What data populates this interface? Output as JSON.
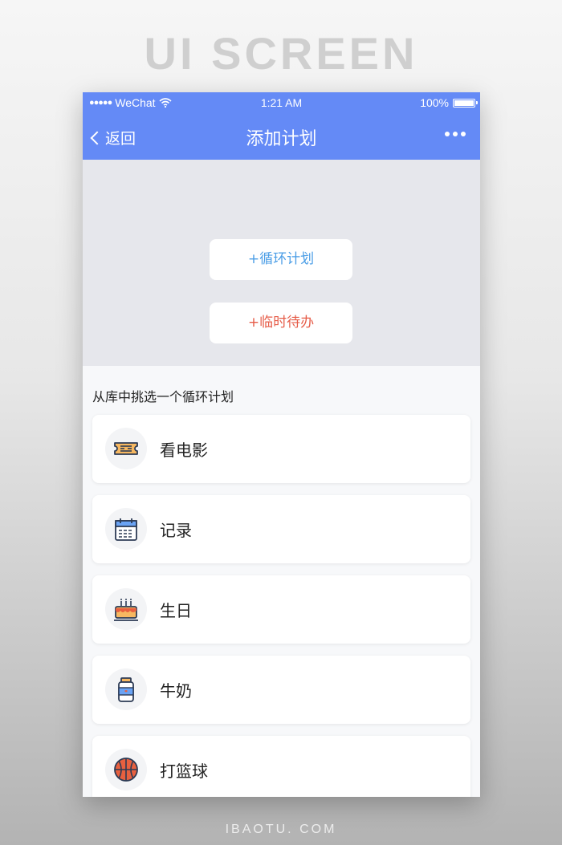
{
  "page": {
    "header_title": "UI SCREEN",
    "footer_text": "IBAOTU. COM"
  },
  "status_bar": {
    "carrier": "WeChat",
    "time": "1:21 AM",
    "battery": "100%"
  },
  "nav": {
    "back_label": "返回",
    "title": "添加计划"
  },
  "hero": {
    "loop_plan_label": "+循环计划",
    "todo_label": "+临时待办",
    "loop_color": "#4a9de6",
    "todo_color": "#e65c48"
  },
  "library": {
    "section_title": "从库中挑选一个循环计划",
    "items": [
      {
        "label": "看电影",
        "icon": "ticket-icon"
      },
      {
        "label": "记录",
        "icon": "calendar-icon"
      },
      {
        "label": "生日",
        "icon": "cake-icon"
      },
      {
        "label": "牛奶",
        "icon": "milk-jar-icon"
      },
      {
        "label": "打篮球",
        "icon": "basketball-icon"
      }
    ]
  },
  "colors": {
    "accent": "#648af6",
    "hero_background": "#e6e7ec"
  }
}
